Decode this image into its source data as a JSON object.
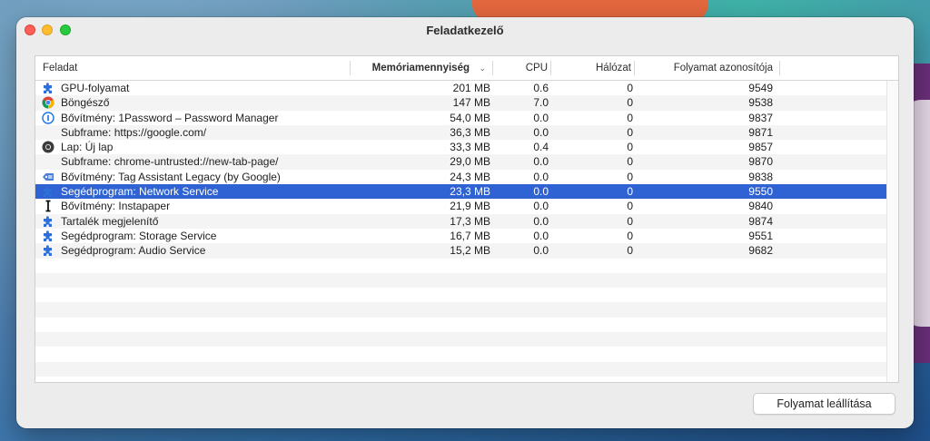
{
  "window": {
    "title": "Feladatkezelő"
  },
  "columns": {
    "task": "Feladat",
    "memory": "Memóriamennyiség",
    "cpu": "CPU",
    "network": "Hálózat",
    "pid": "Folyamat azonosítója"
  },
  "rows": [
    {
      "icon": "puzzle-icon",
      "task": "GPU-folyamat",
      "memory": "201 MB",
      "cpu": "0.6",
      "network": "0",
      "pid": "9549"
    },
    {
      "icon": "chrome-icon",
      "task": "Böngésző",
      "memory": "147 MB",
      "cpu": "7.0",
      "network": "0",
      "pid": "9538"
    },
    {
      "icon": "1password-icon",
      "task": "Bővítmény: 1Password – Password Manager",
      "memory": "54,0 MB",
      "cpu": "0.0",
      "network": "0",
      "pid": "9837"
    },
    {
      "icon": "",
      "task": "Subframe: https://google.com/",
      "memory": "36,3 MB",
      "cpu": "0.0",
      "network": "0",
      "pid": "9871"
    },
    {
      "icon": "chrome-tab-icon",
      "task": "Lap: Új lap",
      "memory": "33,3 MB",
      "cpu": "0.4",
      "network": "0",
      "pid": "9857"
    },
    {
      "icon": "",
      "task": "Subframe: chrome-untrusted://new-tab-page/",
      "memory": "29,0 MB",
      "cpu": "0.0",
      "network": "0",
      "pid": "9870"
    },
    {
      "icon": "tag-icon",
      "task": "Bővítmény: Tag Assistant Legacy (by Google)",
      "memory": "24,3 MB",
      "cpu": "0.0",
      "network": "0",
      "pid": "9838"
    },
    {
      "icon": "puzzle-icon",
      "task": "Segédprogram: Network Service",
      "memory": "23,3 MB",
      "cpu": "0.0",
      "network": "0",
      "pid": "9550",
      "selected": true
    },
    {
      "icon": "instapaper-icon",
      "task": "Bővítmény: Instapaper",
      "memory": "21,9 MB",
      "cpu": "0.0",
      "network": "0",
      "pid": "9840"
    },
    {
      "icon": "puzzle-icon",
      "task": "Tartalék megjelenítő",
      "memory": "17,3 MB",
      "cpu": "0.0",
      "network": "0",
      "pid": "9874"
    },
    {
      "icon": "puzzle-icon",
      "task": "Segédprogram: Storage Service",
      "memory": "16,7 MB",
      "cpu": "0.0",
      "network": "0",
      "pid": "9551"
    },
    {
      "icon": "puzzle-icon",
      "task": "Segédprogram: Audio Service",
      "memory": "15,2 MB",
      "cpu": "0.0",
      "network": "0",
      "pid": "9682"
    }
  ],
  "end_process_button": "Folyamat leállítása",
  "colors": {
    "selection": "#2f62d2",
    "puzzle": "#2f6fd8"
  }
}
